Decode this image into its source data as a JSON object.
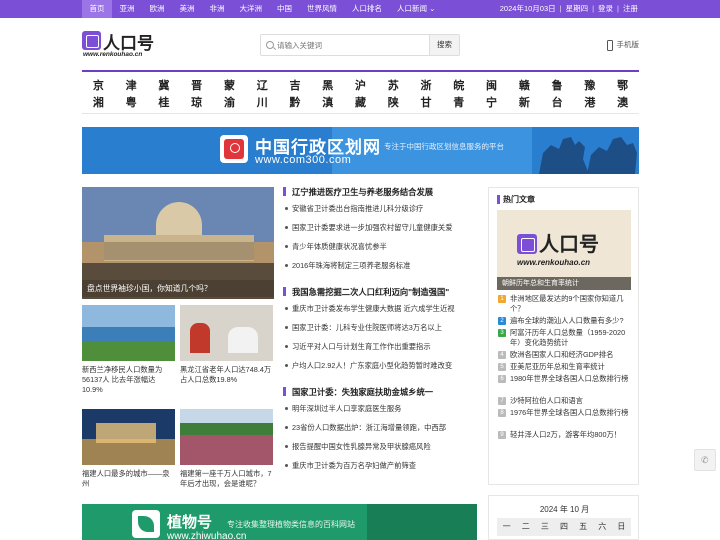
{
  "topnav": {
    "items": [
      "首页",
      "亚洲",
      "欧洲",
      "美洲",
      "非洲",
      "大洋洲",
      "中国",
      "世界风情",
      "人口排名",
      "人口新闻"
    ],
    "date": "2024年10月03日",
    "weekday": "星期四",
    "login": "登录",
    "register": "注册"
  },
  "header": {
    "logo_text": "人口号",
    "logo_url": "www.renkouhao.cn",
    "search_placeholder": "请输入关键词",
    "search_button": "搜索",
    "mobile_label": "手机版"
  },
  "provinces": {
    "row1": [
      "京",
      "津",
      "冀",
      "晋",
      "蒙",
      "辽",
      "吉",
      "黑",
      "沪",
      "苏",
      "浙",
      "皖",
      "闽",
      "赣",
      "鲁",
      "豫",
      "鄂"
    ],
    "row2": [
      "湘",
      "粤",
      "桂",
      "琼",
      "渝",
      "川",
      "黔",
      "滇",
      "藏",
      "陕",
      "甘",
      "青",
      "宁",
      "新",
      "台",
      "港",
      "澳"
    ]
  },
  "banner": {
    "title": "中国行政区划网",
    "url": "www.com300.com",
    "subtitle": "专注于中国行政区划信息服务的平台"
  },
  "feature": {
    "caption": "盘点世界袖珍小国，你知道几个吗？"
  },
  "thumbs": [
    {
      "title": "新西兰净移民人口数量为56137人 比去年涨幅达10.9%"
    },
    {
      "title": "黑龙江省老年人口达748.4万 占人口总数19.8%"
    },
    {
      "title": "福建人口最多的城市——泉州"
    },
    {
      "title": "福建第一座千万人口城市，7年后才出现，会是谁呢？"
    }
  ],
  "news": [
    {
      "headline": "辽宁推进医疗卫生与养老服务结合发展",
      "items": [
        "安徽省卫计委出台指南推进儿科分级诊疗",
        "国家卫计委要求进一步加强农村留守儿童健康关爱",
        "青少年体质健康状况喜忧参半",
        "2016年珠海将制定三项养老服务标准"
      ]
    },
    {
      "headline": "我国急需挖掘二次人口红利迈向\"制造强国\"",
      "items": [
        "重庆市卫计委发布学生健康大数据 近六成学生近视",
        "国家卫计委：儿科专业住院医师将达3万名以上",
        "习近平对人口与计划生育工作作出重要指示",
        "户均人口2.92人！广东家庭小型化趋势暂时难改变"
      ]
    },
    {
      "headline": "国家卫计委：失独家庭扶助金城乡统一",
      "items": [
        "明年深圳过半人口享家庭医生服务",
        "23省份人口数据出炉：浙江海增量领跑，中西部",
        "报告提醒中国女性乳腺异常及甲状腺癌风险",
        "重庆市卫计委为百万名孕妇做产前筛查"
      ]
    }
  ],
  "bottom_banner": {
    "title": "植物号",
    "subtitle": "专注收集整理植物类信息的百科网站",
    "url": "www.zhiwuhao.cn"
  },
  "hot": {
    "heading": "热门文章",
    "pic_logo": "人口号",
    "pic_url": "www.renkouhao.cn",
    "pic_caption": "朝鲜历年总和生育率统计",
    "items": [
      {
        "num": "1",
        "text": "非洲地区最发达的9个国家你知道几个？"
      },
      {
        "num": "2",
        "text": "遍布全球的潮汕人人口数量有多少?"
      },
      {
        "num": "3",
        "text": "阿富汗历年人口总数量（1959-2020年）变化趋势统计"
      },
      {
        "num": "4",
        "text": "欧洲各国家人口和经济GDP排名"
      },
      {
        "num": "5",
        "text": "亚美尼亚历年总和生育率统计"
      },
      {
        "num": "6",
        "text": "1980年世界全球各国人口总数排行榜"
      },
      {
        "num": "7",
        "text": "沙特阿拉伯人口和语言"
      },
      {
        "num": "8",
        "text": "1976年世界全球各国人口总数排行榜"
      },
      {
        "num": "9",
        "text": "轻井泽人口2万，游客年均800万！"
      }
    ],
    "num_colors": [
      "#f0a830",
      "#2b8ad8",
      "#3aa84a"
    ]
  },
  "calendar": {
    "title": "2024 年 10 月",
    "days": [
      "一",
      "二",
      "三",
      "四",
      "五",
      "六",
      "日"
    ]
  }
}
